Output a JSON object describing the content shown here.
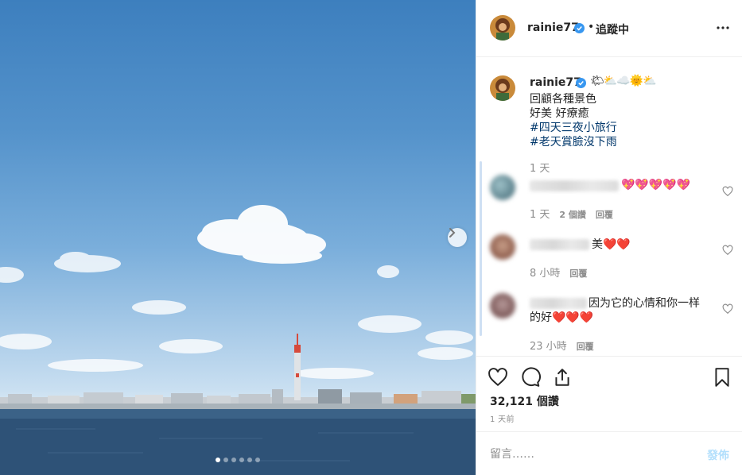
{
  "post": {
    "carousel": {
      "slide_count": 6,
      "active_index": 0
    }
  },
  "header": {
    "username": "rainie77",
    "separator": "•",
    "follow_status": "追蹤中"
  },
  "caption": {
    "username": "rainie77",
    "weather_emoji": "🌤⛅☁️🌞⛅",
    "lines": [
      "回顧各種景色",
      "好美 好療癒"
    ],
    "hashtags": [
      "#四天三夜小旅行",
      "#老天賞臉沒下雨"
    ],
    "time": "1 天"
  },
  "comments": [
    {
      "text": "💖💖💖💖💖",
      "time": "1 天",
      "likes": "2 個讚",
      "reply": "回覆"
    },
    {
      "text": "美❤️❤️",
      "time": "8 小時",
      "reply": "回覆"
    },
    {
      "text_line1": "因为它的心情和你一样",
      "text_line2": "的好❤️❤️❤️",
      "time": "23 小時",
      "reply": "回覆"
    }
  ],
  "stats": {
    "likes": "32,121 個讚",
    "time_ago": "1 天前"
  },
  "comment_box": {
    "placeholder": "留言……",
    "post_label": "發佈"
  },
  "colors": {
    "verified": "#3897f0",
    "hashtag": "#00376b",
    "post_button_disabled": "#b2dffc"
  }
}
